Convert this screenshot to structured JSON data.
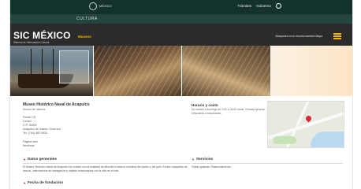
{
  "topbar": {
    "gov_logo_text": "MÉXICO",
    "nav": [
      "Trámites",
      "Gobierno"
    ]
  },
  "culture_bar": {
    "label": "CULTURA"
  },
  "notice": {
    "text": ""
  },
  "sic": {
    "title": "SIC MÉXICO",
    "subtitle": "Sistema de Información Cultural",
    "section": "Museos",
    "search_label": "Búsqueda en un recurso también Mapa"
  },
  "museum": {
    "name": "Museo Histórico Naval de Acapulco",
    "type": "Museo de historia",
    "address_lines": [
      "Fuerte CE",
      "Centro",
      "C.P. 39300",
      "Acapulco de Juárez, Guerrero",
      "Tel. (744) 483 9533"
    ],
    "web_lines": [
      "Página web",
      "facebook"
    ]
  },
  "schedule": {
    "title": "Horario y costo",
    "text": "De martes a domingo de 9:00 a 18:00 horas. Entrada general. Descuento a estudiantes."
  },
  "sections": {
    "general_title": "Datos generales",
    "general_text": "El Museo Histórico Naval de Acapulco fue creado con la finalidad de difundir la historia marítima del puerto y del país. Exhibe maquetas de barcos, instrumentos de navegación y objetos relacionados con la vida en el mar.",
    "services_title": "Servicios",
    "services_text": "Visitas guiadas. Estacionamiento.",
    "history_title": "Fecha de fundación"
  }
}
